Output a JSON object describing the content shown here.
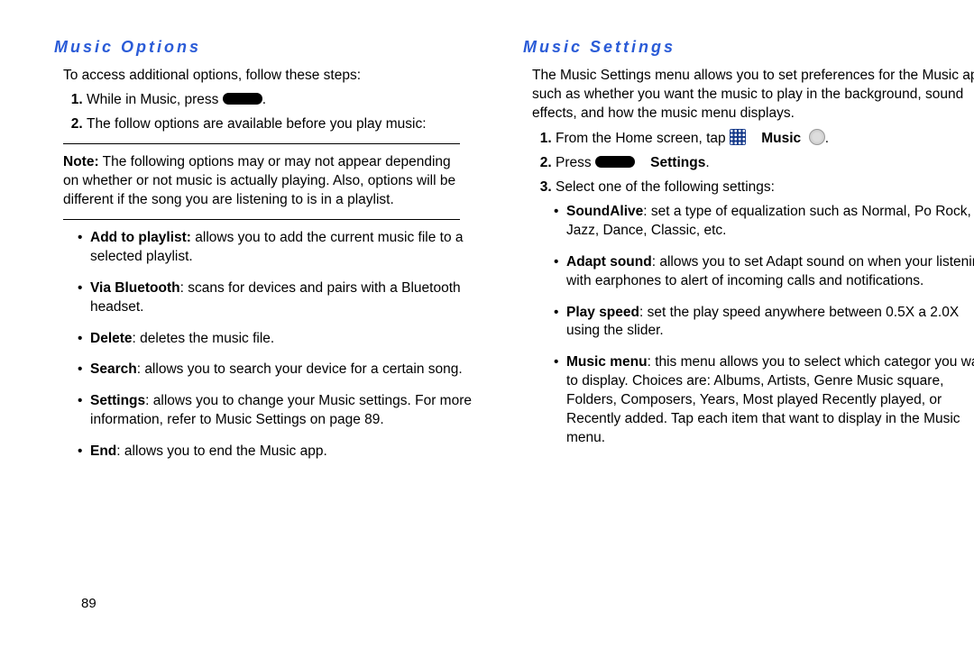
{
  "left": {
    "title": "Music Options",
    "intro": "To access additional options, follow these steps:",
    "step1_a": "While in Music, press ",
    "step1_b": ".",
    "step2": "The follow options are available before you play music:",
    "note_label": "Note:",
    "note_body": " The following options may or may not appear depending on whether or not music is actually playing. Also, options will be different if the song you are listening to is in a playlist.",
    "opts": {
      "addplaylist_b": "Add to playlist:",
      "addplaylist_t": " allows you to add the current music file to a selected playlist.",
      "bt_b": "Via Bluetooth",
      "bt_t": ": scans for devices and pairs with a Bluetooth headset.",
      "del_b": "Delete",
      "del_t": ": deletes the music file.",
      "search_b": "Search",
      "search_t": ": allows you to search your device for a certain song.",
      "settings_b": "Settings",
      "settings_t": ": allows you to change your Music settings. For more information, refer to Music Settings on page 89.",
      "end_b": "End",
      "end_t": ": allows you to end the Music app."
    }
  },
  "right": {
    "title": "Music Settings",
    "intro": "The Music Settings menu allows you to set preferences for the Music app such as whether you want the music to play in the background, sound effects, and how the music menu displays.",
    "step1_a": "From the Home screen, tap ",
    "step1_music": "Music",
    "step1_d": ".",
    "step2_a": "Press ",
    "step2_settings": "Settings",
    "step2_b": ".",
    "step3": "Select one of the following settings:",
    "opts": {
      "sa_b": "SoundAlive",
      "sa_t": ": set a type of equalization such as Normal, Po Rock, Jazz, Dance, Classic, etc.",
      "as_b": "Adapt sound",
      "as_t": ": allows you to set Adapt sound on when your listening with earphones to alert of incoming calls and notifications.",
      "ps_b": "Play speed",
      "ps_t": ": set the play speed anywhere between 0.5X a 2.0X using the slider.",
      "mm_b": "Music menu",
      "mm_t": ": this menu allows you to select which categor you want to display. Choices are: Albums, Artists, Genre Music square, Folders, Composers, Years, Most played Recently played, or Recently added. Tap each item that want to display in the Music menu."
    }
  },
  "page_number": "89"
}
